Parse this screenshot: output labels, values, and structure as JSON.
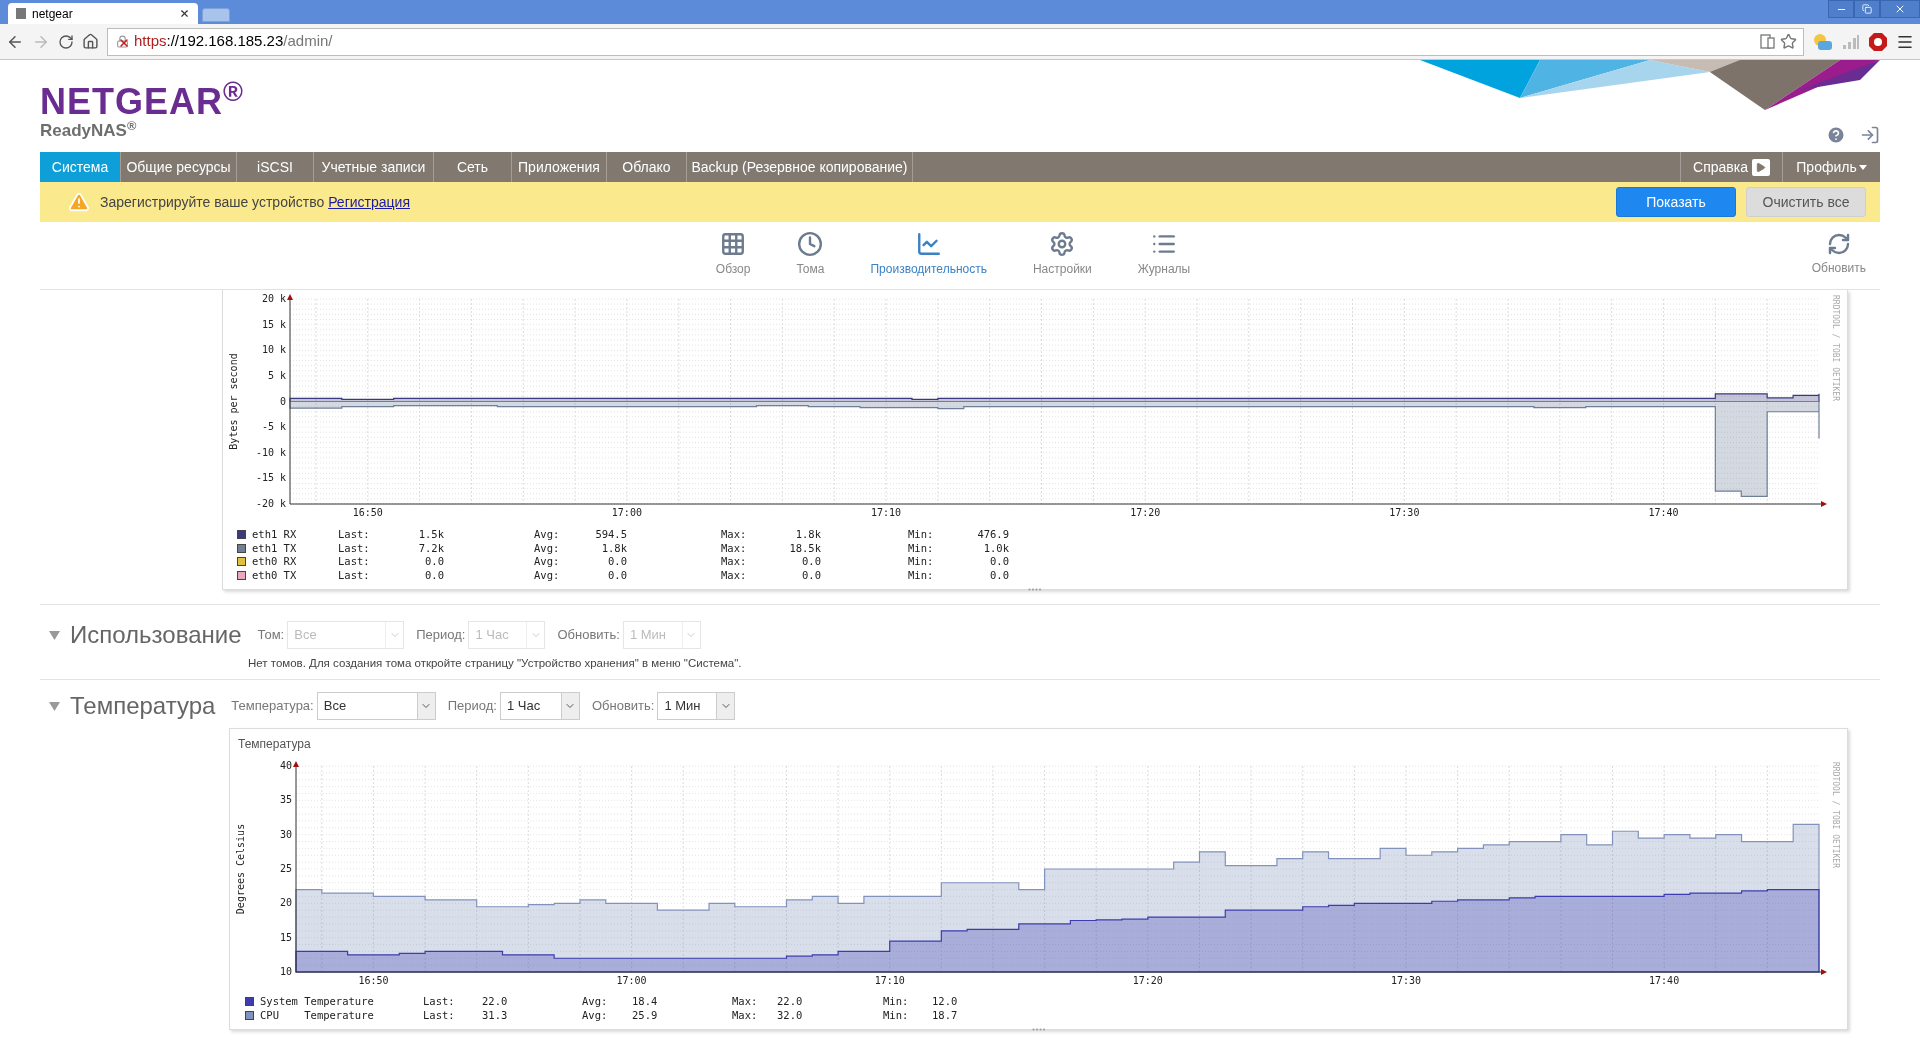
{
  "browser": {
    "tabs": [
      {
        "title": "netgear",
        "selected": true
      }
    ],
    "address": {
      "scheme": "https",
      "host": "://192.168.185.23",
      "path": "/admin/",
      "insecure": true
    }
  },
  "header": {
    "brand": "NETGEAR$^{®}$",
    "product": "ReadyNAS$^{®}$"
  },
  "nav": {
    "items": [
      {
        "label": "Система",
        "selected": true
      },
      {
        "label": "Общие ресурсы",
        "selected": false
      },
      {
        "label": "iSCSI",
        "selected": false
      },
      {
        "label": "Учетные записи",
        "selected": false
      },
      {
        "label": "Сеть",
        "selected": false
      },
      {
        "label": "Приложения",
        "selected": false
      },
      {
        "label": "Облако",
        "selected": false
      },
      {
        "label": "Backup (Резервное копирование)",
        "selected": false
      }
    ],
    "help": "Справка",
    "profile": "Профиль"
  },
  "notice": {
    "text": "Зарегистрируйте ваше устройство",
    "link": "Регистрация",
    "buttons": [
      {
        "label": "Показать",
        "kind": "primary"
      },
      {
        "label": "Очистить все",
        "kind": "secondary"
      }
    ]
  },
  "toolbar": {
    "tabs": [
      {
        "label": "Обзор",
        "selected": false
      },
      {
        "label": "Тома",
        "selected": false
      },
      {
        "label": "Производительность",
        "selected": true
      },
      {
        "label": "Настройки",
        "selected": false
      },
      {
        "label": "Журналы",
        "selected": false
      }
    ],
    "refresh": "Обновить"
  },
  "network_chart": {
    "credit": "RRDTOOL / TOBI OETIKER",
    "legend": [
      {
        "stats": [
          {
            "label": "Last:",
            "value": "1.5k"
          },
          {
            "label": "Avg:",
            "value": "594.5"
          },
          {
            "label": "Max:",
            "value": "1.8k"
          },
          {
            "label": "Min:",
            "value": "476.9"
          }
        ]
      },
      {
        "stats": [
          {
            "label": "Last:",
            "value": "7.2k"
          },
          {
            "label": "Avg:",
            "value": "1.8k"
          },
          {
            "label": "Max:",
            "value": "18.5k"
          },
          {
            "label": "Min:",
            "value": "1.0k"
          }
        ]
      },
      {
        "name": "eth0 RX",
        "color": "#e0c040",
        "stats": [
          {
            "label": "Last:",
            "value": "0.0"
          },
          {
            "label": "Avg:",
            "value": "0.0"
          },
          {
            "label": "Max:",
            "value": "0.0"
          },
          {
            "label": "Min:",
            "value": "0.0"
          }
        ]
      },
      {
        "name": "eth0 TX",
        "color": "#e8a8c0",
        "stats": [
          {
            "label": "Last:",
            "value": "0.0"
          },
          {
            "label": "Avg:",
            "value": "0.0"
          },
          {
            "label": "Max:",
            "value": "0.0"
          },
          {
            "label": "Min:",
            "value": "0.0"
          }
        ]
      }
    ],
    "chart_data": {
      "type": "area",
      "ylabel": "Bytes per second",
      "stacked": false,
      "grid": true,
      "ylim": [
        -20000,
        20000
      ],
      "categories": [
        null,
        null,
        null,
        "16:50",
        null,
        null,
        null,
        null,
        null,
        null,
        null,
        null,
        null,
        "17:00",
        null,
        null,
        null,
        null,
        null,
        null,
        null,
        null,
        null,
        "17:10",
        null,
        null,
        null,
        null,
        null,
        null,
        null,
        null,
        null,
        "17:20",
        null,
        null,
        null,
        null,
        null,
        null,
        null,
        null,
        null,
        "17:30",
        null,
        null,
        null,
        null,
        null,
        null,
        null,
        null,
        null,
        "17:40",
        null,
        null,
        null,
        null,
        null,
        null
      ],
      "yticks": [
        {
          "value": 20000,
          "label": "20 k"
        },
        {
          "value": 15000,
          "label": "15 k"
        },
        {
          "value": 10000,
          "label": "10 k"
        },
        {
          "value": 5000,
          "label": "5 k"
        },
        {
          "value": 0,
          "label": "0"
        },
        {
          "value": -5000,
          "label": "-5 k"
        },
        {
          "value": -10000,
          "label": "-10 k"
        },
        {
          "value": -15000,
          "label": "-15 k"
        },
        {
          "value": -20000,
          "label": "-20 k"
        }
      ],
      "series": [
        {
          "name": "eth1 RX",
          "color": "#3a3a80",
          "values": [
            600,
            600,
            400,
            400,
            600,
            600,
            600,
            600,
            600,
            600,
            600,
            600,
            600,
            600,
            600,
            600,
            600,
            600,
            600,
            600,
            600,
            600,
            600,
            600,
            400,
            600,
            600,
            600,
            600,
            600,
            600,
            600,
            600,
            600,
            600,
            600,
            600,
            600,
            600,
            600,
            600,
            600,
            600,
            600,
            600,
            600,
            600,
            600,
            600,
            600,
            600,
            600,
            600,
            600,
            600,
            1500,
            1500,
            700,
            1200,
            1500
          ]
        },
        {
          "name": "eth1 TX",
          "color": "#6f7f98",
          "values": [
            -1300,
            -1300,
            -1000,
            -1000,
            -800,
            -800,
            -800,
            -800,
            -1000,
            -1000,
            -1000,
            -1000,
            -1000,
            -1000,
            -1000,
            -1000,
            -1000,
            -1000,
            -800,
            -800,
            -1000,
            -1000,
            -1200,
            -1200,
            -1200,
            -1400,
            -1000,
            -1000,
            -1000,
            -1000,
            -1000,
            -1000,
            -1000,
            -1000,
            -1000,
            -1000,
            -1000,
            -1000,
            -1000,
            -1000,
            -1000,
            -1000,
            -1000,
            -1000,
            -1000,
            -1000,
            -1000,
            -1000,
            -1200,
            -1200,
            -1000,
            -1000,
            -1000,
            -1000,
            -1000,
            -17500,
            -18500,
            -2000,
            -2000,
            -7200
          ]
        }
      ]
    }
  },
  "usage": {
    "title": "Использование",
    "expanded": true,
    "filters": [
      {
        "label": "Том:",
        "value": "Все",
        "disabled": true
      },
      {
        "label": "Период:",
        "value": "1 Час",
        "disabled": true
      },
      {
        "label": "Обновить:",
        "value": "1 Мин",
        "disabled": true
      }
    ],
    "message": "Нет томов. Для создания тома откройте страницу \"Устройство хранения\" в меню \"Система\"."
  },
  "temperature": {
    "title": "Температура",
    "expanded": true,
    "filters": [
      {
        "label": "Температура:",
        "value": "Все",
        "disabled": false
      },
      {
        "label": "Период:",
        "value": "1 Час",
        "disabled": false
      },
      {
        "label": "Обновить:",
        "value": "1 Мин",
        "disabled": false
      }
    ],
    "chart_title": "Температура",
    "credit": "RRDTOOL / TOBI OETIKER",
    "legend": [
      {
        "stats": [
          {
            "label": "Last:",
            "value": "22.0"
          },
          {
            "label": "Avg:",
            "value": "18.4"
          },
          {
            "label": "Max:",
            "value": "22.0"
          },
          {
            "label": "Min:",
            "value": "12.0"
          }
        ]
      },
      {
        "stats": [
          {
            "label": "Last:",
            "value": "31.3"
          },
          {
            "label": "Avg:",
            "value": "25.9"
          },
          {
            "label": "Max:",
            "value": "32.0"
          },
          {
            "label": "Min:",
            "value": "18.7"
          }
        ]
      }
    ],
    "chart_data": {
      "type": "area",
      "ylabel": "Degrees Celsius",
      "stacked": false,
      "grid": true,
      "ylim": [
        10,
        40
      ],
      "categories": [
        null,
        null,
        null,
        "16:50",
        null,
        null,
        null,
        null,
        null,
        null,
        null,
        null,
        null,
        "17:00",
        null,
        null,
        null,
        null,
        null,
        null,
        null,
        null,
        null,
        "17:10",
        null,
        null,
        null,
        null,
        null,
        null,
        null,
        null,
        null,
        "17:20",
        null,
        null,
        null,
        null,
        null,
        null,
        null,
        null,
        null,
        "17:30",
        null,
        null,
        null,
        null,
        null,
        null,
        null,
        null,
        null,
        "17:40",
        null,
        null,
        null,
        null,
        null,
        null
      ],
      "yticks": [
        40,
        35,
        30,
        25,
        20,
        15,
        10
      ],
      "series": [
        {
          "name": "CPU    Temperature",
          "color": "#8292bc",
          "values": [
            22,
            21.5,
            21.5,
            21,
            21,
            20.5,
            20.5,
            19.5,
            19.5,
            19.8,
            20,
            20.5,
            20,
            20,
            19,
            19,
            20,
            19.5,
            19.5,
            20.5,
            21,
            20,
            21,
            21,
            21,
            23,
            23,
            23,
            22,
            25,
            25,
            25,
            25,
            25,
            26,
            27.5,
            25.5,
            25.5,
            26.5,
            27.5,
            26.5,
            26.5,
            28,
            27,
            27.5,
            28,
            28.5,
            29,
            29,
            30,
            28.5,
            30.5,
            29.5,
            30,
            29.5,
            30,
            29,
            29,
            31.5,
            31.3
          ]
        },
        {
          "name": "System Temperature",
          "color": "#3c3cb0",
          "values": [
            13,
            13,
            12.5,
            12.5,
            12.7,
            13,
            13,
            13,
            12.5,
            12.5,
            12,
            12,
            12,
            12,
            12,
            12,
            12,
            12,
            12,
            12.3,
            12.5,
            13,
            13,
            14.5,
            14.5,
            16,
            16.2,
            16.2,
            17,
            17,
            17.5,
            17.6,
            17.7,
            18,
            18,
            18,
            19,
            19,
            19,
            19.5,
            19.7,
            20,
            20,
            20,
            20.3,
            20.5,
            20.5,
            20.8,
            21,
            21,
            21,
            21,
            21,
            21.3,
            21.5,
            21.5,
            21.8,
            22,
            22,
            22
          ]
        }
      ]
    }
  }
}
